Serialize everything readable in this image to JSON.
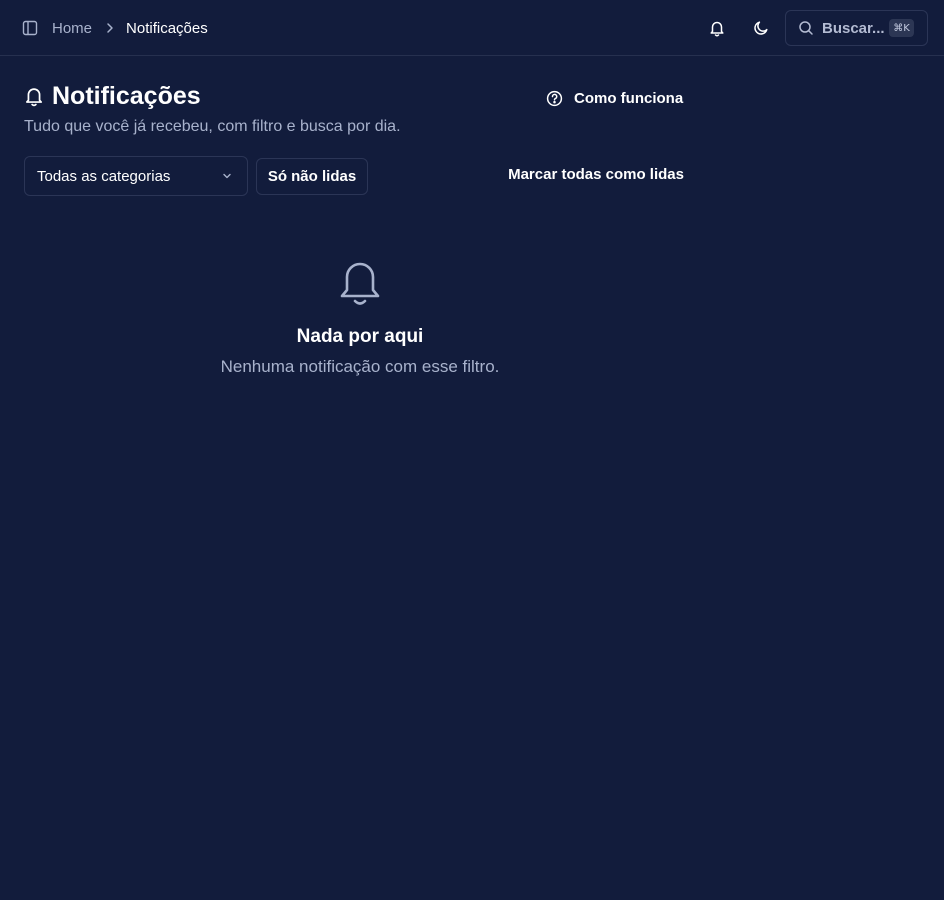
{
  "header": {
    "breadcrumb": {
      "home": "Home",
      "current": "Notificações"
    },
    "search": {
      "label": "Buscar...",
      "shortcut": "⌘K"
    },
    "icons": [
      "sidebar-toggle-icon",
      "chevron-right-icon",
      "bell-icon",
      "moon-icon",
      "search-icon"
    ]
  },
  "page": {
    "title": "Notificações",
    "subtitle": "Tudo que você já recebeu, com filtro e busca por dia.",
    "help_label": "Como funciona"
  },
  "filters": {
    "category_selected": "Todas as categorias",
    "unread_label": "Só não lidas",
    "mark_all_label": "Marcar todas como lidas"
  },
  "empty_state": {
    "title": "Nada por aqui",
    "description": "Nenhuma notificação com esse filtro."
  },
  "colors": {
    "background": "#121c3c",
    "border": "#2b3556",
    "muted_text": "#a8b2cc",
    "text": "#ffffff"
  }
}
